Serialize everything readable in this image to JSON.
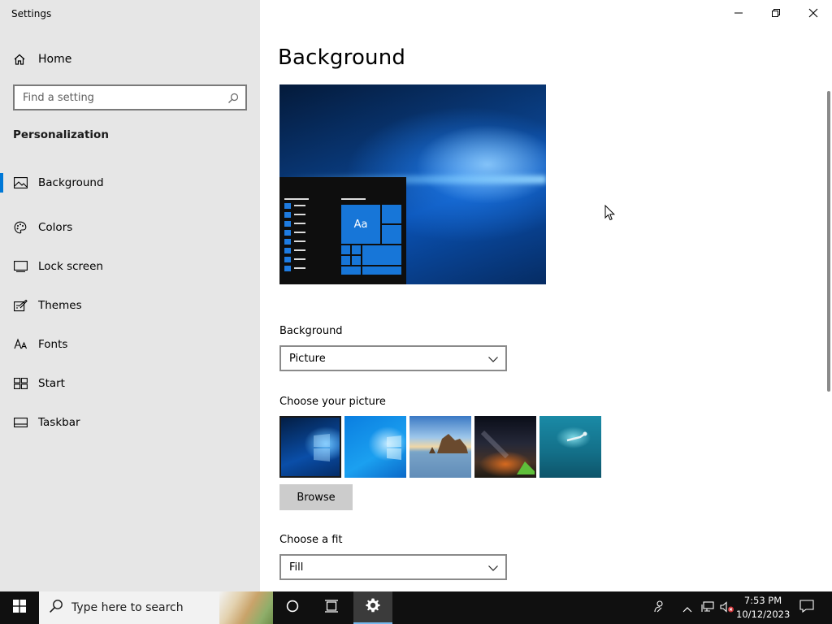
{
  "window": {
    "title": "Settings",
    "controls": [
      "minimize",
      "restore",
      "close"
    ]
  },
  "sidebar": {
    "home_label": "Home",
    "search_placeholder": "Find a setting",
    "section_title": "Personalization",
    "items": [
      {
        "label": "Background",
        "icon": "picture-icon",
        "active": true
      },
      {
        "label": "Colors",
        "icon": "palette-icon",
        "active": false
      },
      {
        "label": "Lock screen",
        "icon": "lock-screen-icon",
        "active": false
      },
      {
        "label": "Themes",
        "icon": "themes-icon",
        "active": false
      },
      {
        "label": "Fonts",
        "icon": "fonts-icon",
        "active": false
      },
      {
        "label": "Start",
        "icon": "start-icon",
        "active": false
      },
      {
        "label": "Taskbar",
        "icon": "taskbar-icon",
        "active": false
      }
    ]
  },
  "main": {
    "page_title": "Background",
    "preview": {
      "tile_text": "Aa"
    },
    "background_label": "Background",
    "background_value": "Picture",
    "choose_picture_label": "Choose your picture",
    "pictures": [
      "windows-blue-dark",
      "windows-blue-light",
      "coastal-rocks",
      "night-sky",
      "underwater-swimmer"
    ],
    "selected_picture": 0,
    "browse_label": "Browse",
    "fit_label": "Choose a fit",
    "fit_value": "Fill"
  },
  "taskbar": {
    "search_placeholder": "Type here to search",
    "time": "7:53 PM",
    "date": "10/12/2023"
  },
  "colors": {
    "accent": "#0078d7",
    "sidebar_bg": "#e6e6e6",
    "taskbar_bg": "#101010"
  }
}
